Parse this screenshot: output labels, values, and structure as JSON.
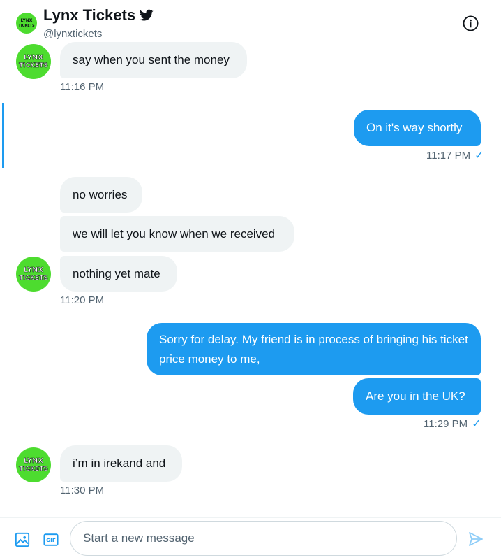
{
  "header": {
    "title": "Lynx Tickets",
    "handle": "@lynxtickets",
    "verified_icon": "bird-icon",
    "info_icon": "info-icon"
  },
  "logo": {
    "line1": "LYNX",
    "line2": "TICKETS",
    "brand_color": "#4ddc2f"
  },
  "conversation": {
    "m1": {
      "text": "say when you sent the money",
      "time": "11:16 PM"
    },
    "m2": {
      "text": "On it's way shortly",
      "time": "11:17 PM"
    },
    "m3": {
      "text": "no worries"
    },
    "m4": {
      "text": "we will let you know when we received"
    },
    "m5": {
      "text": "nothing yet mate",
      "time": "11:20 PM"
    },
    "m6": {
      "text": "Sorry for delay. My friend is in process of bringing his ticket price money to me,"
    },
    "m7": {
      "text": "Are you in the UK?",
      "time": "11:29 PM"
    },
    "m8": {
      "text": "i’m in irekand and",
      "time": "11:30 PM"
    }
  },
  "read_mark": "✓",
  "composer": {
    "placeholder": "Start a new message",
    "gif_label": "GIF",
    "media_icon": "image-icon",
    "send_icon": "send-icon"
  },
  "colors": {
    "accent": "#1d9bf0",
    "incoming_bubble": "#eff3f4"
  }
}
